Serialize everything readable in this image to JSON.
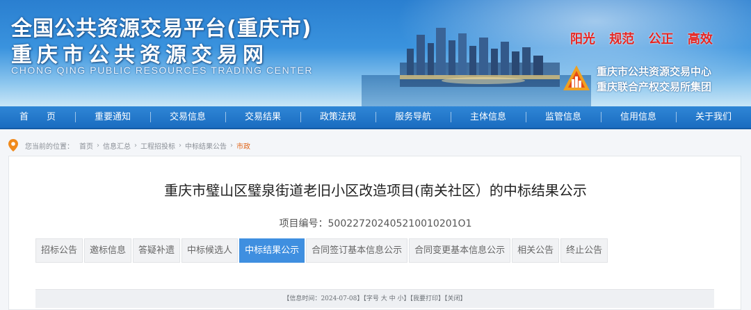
{
  "header": {
    "title_line1": "全国公共资源交易平台(重庆市)",
    "title_line2": "重庆市公共资源交易网",
    "title_en": "CHONG QING PUBLIC RESOURCES TRADING CENTER",
    "slogan": [
      "阳光",
      "规范",
      "公正",
      "高效"
    ],
    "org_line1": "重庆市公共资源交易中心",
    "org_line2": "重庆联合产权交易所集团",
    "colors": {
      "banner": "#2a7fd0",
      "slogan": "#e62522",
      "nav": "#1a6cc0"
    }
  },
  "nav": {
    "items": [
      {
        "label": "首　　页"
      },
      {
        "label": "重要通知"
      },
      {
        "label": "交易信息"
      },
      {
        "label": "交易结果"
      },
      {
        "label": "政策法规"
      },
      {
        "label": "服务导航"
      },
      {
        "label": "主体信息"
      },
      {
        "label": "监管信息"
      },
      {
        "label": "信用信息"
      },
      {
        "label": "关于我们"
      }
    ]
  },
  "breadcrumb": {
    "prefix": "您当前的位置：",
    "items": [
      "首页",
      "信息汇总",
      "工程招投标",
      "中标结果公告"
    ],
    "current": "市政",
    "separator": "›"
  },
  "main": {
    "title": "重庆市璧山区璧泉街道老旧小区改造项目(南关社区）的中标结果公示",
    "project_no_label": "项目编号：",
    "project_no": "500227202405210010201O1",
    "tabs": [
      {
        "label": "招标公告"
      },
      {
        "label": "邀标信息"
      },
      {
        "label": "答疑补遗"
      },
      {
        "label": "中标候选人"
      },
      {
        "label": "中标结果公示",
        "active": true
      },
      {
        "label": "合同签订基本信息公示"
      },
      {
        "label": "合同变更基本信息公示"
      },
      {
        "label": "相关公告"
      },
      {
        "label": "终止公告"
      }
    ],
    "active_tab_color": "#3f8fe0",
    "info_bar": {
      "time_prefix": "【信息时间：",
      "time": "2024-07-08",
      "time_suffix": "】",
      "font_label": "【字号",
      "font_big": "大",
      "font_mid": "中",
      "font_small": "小】",
      "print": "【我要打印】",
      "close": "【关闭】"
    }
  }
}
